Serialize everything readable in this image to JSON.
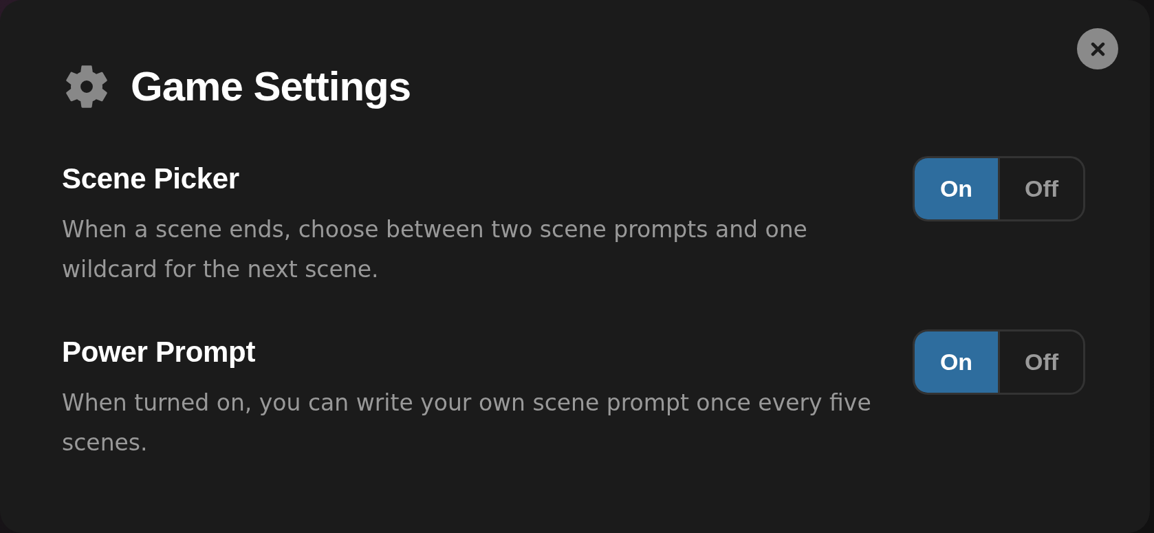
{
  "dialog": {
    "title": "Game Settings"
  },
  "settings": [
    {
      "title": "Scene Picker",
      "description": "When a scene ends, choose between two scene prompts and one wildcard for the next scene.",
      "options": [
        {
          "label": "On",
          "selected": true
        },
        {
          "label": "Off",
          "selected": false
        }
      ]
    },
    {
      "title": "Power Prompt",
      "description": "When turned on, you can write your own scene prompt once every five scenes.",
      "options": [
        {
          "label": "On",
          "selected": true
        },
        {
          "label": "Off",
          "selected": false
        }
      ]
    }
  ]
}
